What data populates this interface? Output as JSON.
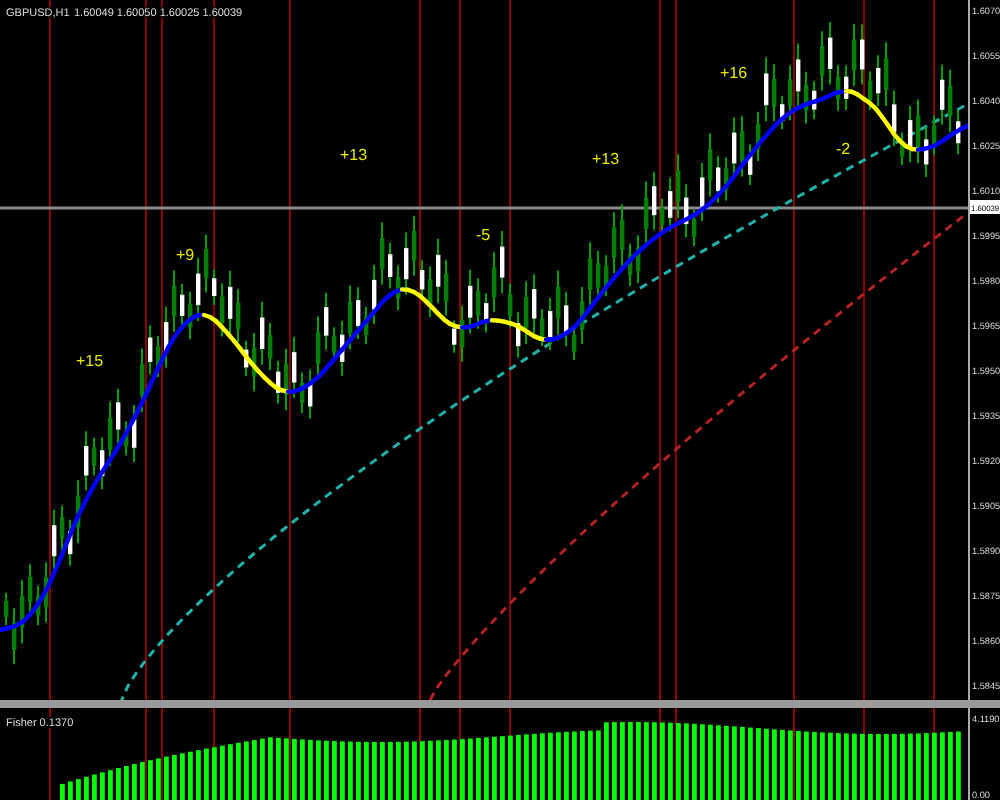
{
  "header": {
    "symbol": "GBPUSD,H1",
    "quote": "1.60049 1.60050 1.60025 1.60039"
  },
  "price_axis": {
    "labels": [
      "1.6070",
      "1.6055",
      "1.6040",
      "1.6025",
      "1.6010",
      "1.5995",
      "1.5980",
      "1.5965",
      "1.5950",
      "1.5935",
      "1.5920",
      "1.5905",
      "1.5890",
      "1.5875",
      "1.5860",
      "1.5845"
    ],
    "current_price": "1.60039"
  },
  "annotations": [
    {
      "text": "+15"
    },
    {
      "text": "+9"
    },
    {
      "text": "+13"
    },
    {
      "text": "-5"
    },
    {
      "text": "+13"
    },
    {
      "text": "+16"
    },
    {
      "text": "-2"
    }
  ],
  "indicator": {
    "title": "Fisher 0.1370",
    "axis_labels": [
      "4.1190",
      "0.00"
    ]
  }
}
